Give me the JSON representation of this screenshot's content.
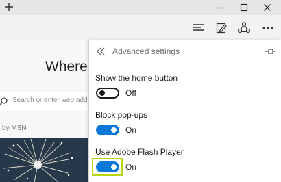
{
  "titlebar": {
    "new_tab_icon": "plus-icon",
    "window_controls": [
      "minimize-icon",
      "maximize-icon",
      "close-icon"
    ]
  },
  "toolbar": {
    "icons": [
      "hub-icon",
      "web-note-icon",
      "share-icon",
      "more-icon"
    ]
  },
  "page": {
    "heading": "Where t",
    "search_placeholder": "Search or enter web add",
    "news_source": "by MSN"
  },
  "panel": {
    "title": "Advanced settings",
    "settings": [
      {
        "label": "Show the home button",
        "state": "Off",
        "on": false
      },
      {
        "label": "Block pop-ups",
        "state": "On",
        "on": true
      },
      {
        "label": "Use Adobe Flash Player",
        "state": "On",
        "on": true
      }
    ]
  },
  "colors": {
    "accent": "#0a78d7",
    "focus_highlight": "#b7d80f"
  }
}
